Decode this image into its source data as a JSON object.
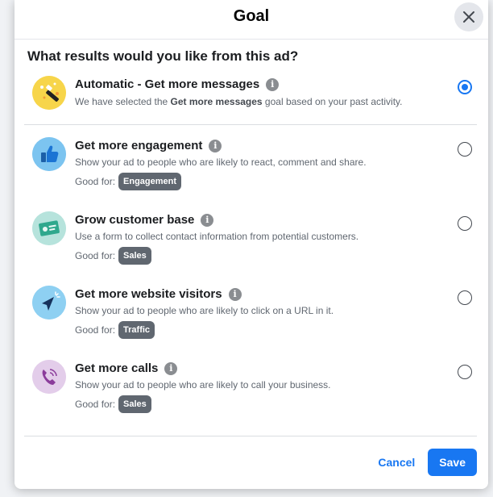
{
  "modal": {
    "title": "Goal",
    "question": "What results would you like from this ad?"
  },
  "good_for_label": "Good for:",
  "options": [
    {
      "title": "Automatic - Get more messages",
      "desc_prefix": "We have selected the ",
      "desc_bold": "Get more messages",
      "desc_suffix": " goal based on your past activity.",
      "selected": true,
      "icon": "magic-wand-icon",
      "icon_bg": "#f7d54a"
    },
    {
      "title": "Get more engagement",
      "desc": "Show your ad to people who are likely to react, comment and share.",
      "tag": "Engagement",
      "selected": false,
      "icon": "thumbs-up-icon",
      "icon_bg": "#7cc4f0"
    },
    {
      "title": "Grow customer base",
      "desc": "Use a form to collect contact information from potential customers.",
      "tag": "Sales",
      "selected": false,
      "icon": "contact-card-icon",
      "icon_bg": "#b6e3dc"
    },
    {
      "title": "Get more website visitors",
      "desc": "Show your ad to people who are likely to click on a URL in it.",
      "tag": "Traffic",
      "selected": false,
      "icon": "cursor-click-icon",
      "icon_bg": "#8ed0f2"
    },
    {
      "title": "Get more calls",
      "desc": "Show your ad to people who are likely to call your business.",
      "tag": "Sales",
      "selected": false,
      "icon": "phone-icon",
      "icon_bg": "#e3cdea"
    }
  ],
  "footer": {
    "cancel": "Cancel",
    "save": "Save"
  },
  "colors": {
    "accent": "#1877f2",
    "pill": "#606770"
  }
}
